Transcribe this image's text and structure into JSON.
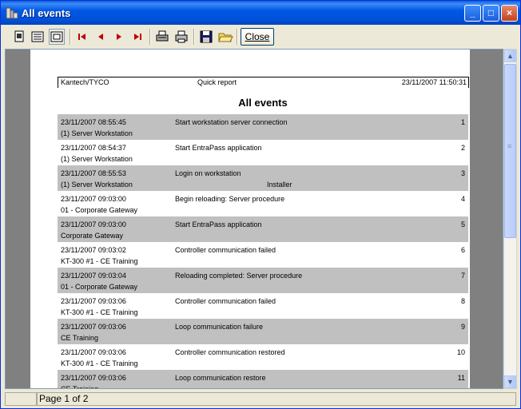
{
  "window": {
    "title": "All events"
  },
  "title_buttons": {
    "minimize": "_",
    "maximize": "□",
    "close": "×"
  },
  "toolbar": {
    "icons": [
      "one-page-icon",
      "multi-page-icon",
      "zoom-fit-icon",
      "first-page-icon",
      "previous-page-icon",
      "next-page-icon",
      "last-page-icon",
      "print-setup-icon",
      "print-icon",
      "save-icon",
      "open-icon"
    ],
    "close_label": "Close"
  },
  "report": {
    "header_left": "Kantech/TYCO",
    "header_center": "Quick report",
    "header_right": "23/11/2007 11:50:31",
    "title": "All events",
    "rows": [
      {
        "time": "23/11/2007 08:55:45",
        "event": "Start workstation server connection",
        "source": "(1)  Server Workstation",
        "extra": "",
        "num": "1"
      },
      {
        "time": "23/11/2007 08:54:37",
        "event": "Start EntraPass application",
        "source": "(1)  Server Workstation",
        "extra": "",
        "num": "2"
      },
      {
        "time": "23/11/2007 08:55:53",
        "event": "Login on workstation",
        "source": "(1)  Server Workstation",
        "extra": "Installer",
        "num": "3"
      },
      {
        "time": "23/11/2007 09:03:00",
        "event": "Begin reloading: Server procedure",
        "source": "01 - Corporate Gateway",
        "extra": "",
        "num": "4"
      },
      {
        "time": "23/11/2007 09:03:00",
        "event": "Start EntraPass application",
        "source": "Corporate Gateway",
        "extra": "",
        "num": "5"
      },
      {
        "time": "23/11/2007 09:03:02",
        "event": "Controller communication failed",
        "source": "KT-300 #1 - CE Training",
        "extra": "",
        "num": "6"
      },
      {
        "time": "23/11/2007 09:03:04",
        "event": "Reloading completed: Server procedure",
        "source": "01 - Corporate Gateway",
        "extra": "",
        "num": "7"
      },
      {
        "time": "23/11/2007 09:03:06",
        "event": "Controller communication failed",
        "source": "KT-300 #1 - CE Training",
        "extra": "",
        "num": "8"
      },
      {
        "time": "23/11/2007 09:03:06",
        "event": "Loop communication failure",
        "source": "CE Training",
        "extra": "",
        "num": "9"
      },
      {
        "time": "23/11/2007 09:03:06",
        "event": "Controller communication restored",
        "source": "KT-300 #1 - CE Training",
        "extra": "",
        "num": "10"
      },
      {
        "time": "23/11/2007 09:03:06",
        "event": "Loop communication restore",
        "source": "CE Training",
        "extra": "",
        "num": "11"
      }
    ]
  },
  "scrollbar": {
    "up": "▲",
    "down": "▼",
    "grip": "≡"
  },
  "status": {
    "page": "Page 1 of 2"
  },
  "colors": {
    "row_shade": "#c0c0c0",
    "titlebar": "#0054e3"
  }
}
